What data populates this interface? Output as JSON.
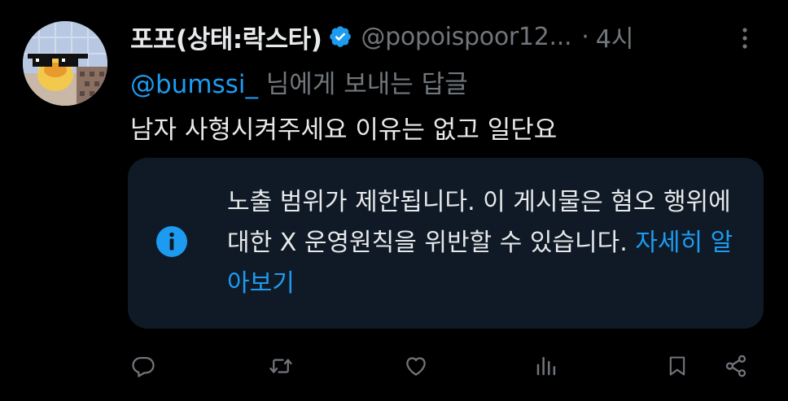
{
  "tweet": {
    "display_name": "포포(상태:락스타)",
    "handle": "@popoispoor12...",
    "separator": "·",
    "time": "4시",
    "reply_to": {
      "mention": "@bumssi_",
      "suffix": " 님에게 보내는 답글"
    },
    "text": "남자 사형시켜주세요 이유는 없고 일단요",
    "notice": {
      "text": "노출 범위가 제한됩니다. 이 게시물은 혐오 행위에 대한 X 운영원칙을 위반할 수 있습니다. ",
      "link": "자세히 알아보기",
      "icon": "info-icon"
    }
  },
  "actions": {
    "icons": [
      "reply-icon",
      "retweet-icon",
      "like-icon",
      "views-icon",
      "bookmark-icon",
      "share-icon"
    ]
  },
  "colors": {
    "background": "#000000",
    "accent": "#1d9bf0",
    "text_primary": "#e7e9ea",
    "text_secondary": "#71767b",
    "notice_background": "#0f1a26"
  }
}
